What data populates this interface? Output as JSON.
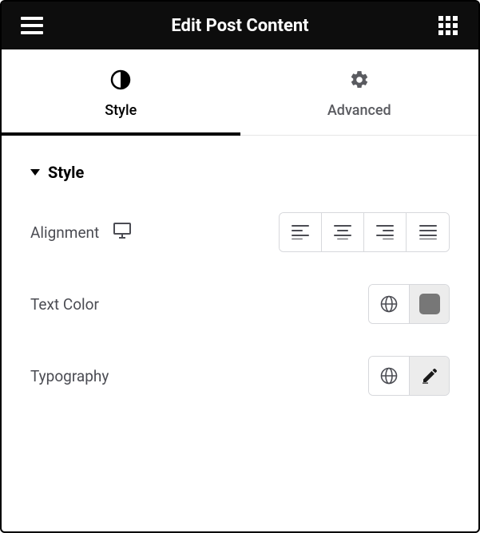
{
  "header": {
    "title": "Edit Post Content"
  },
  "tabs": {
    "items": [
      {
        "label": "Style",
        "active": true
      },
      {
        "label": "Advanced",
        "active": false
      }
    ]
  },
  "section": {
    "title": "Style"
  },
  "controls": {
    "alignment": {
      "label": "Alignment"
    },
    "textColor": {
      "label": "Text Color",
      "swatch": "#777777"
    },
    "typography": {
      "label": "Typography"
    }
  }
}
